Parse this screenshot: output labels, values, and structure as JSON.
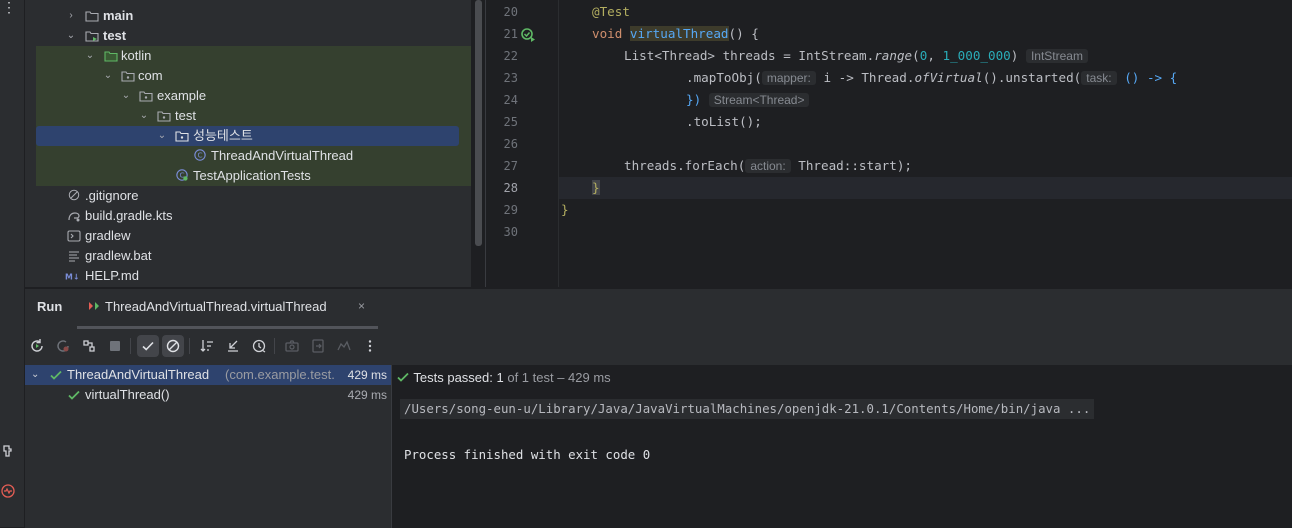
{
  "tree": {
    "rows": [
      {
        "label": "main"
      },
      {
        "label": "test"
      },
      {
        "label": "kotlin"
      },
      {
        "label": "com"
      },
      {
        "label": "example"
      },
      {
        "label": "test"
      },
      {
        "label": "성능테스트"
      },
      {
        "label": "ThreadAndVirtualThread"
      },
      {
        "label": "TestApplicationTests"
      },
      {
        "label": ".gitignore"
      },
      {
        "label": "build.gradle.kts"
      },
      {
        "label": "gradlew"
      },
      {
        "label": "gradlew.bat"
      },
      {
        "label": "HELP.md"
      }
    ]
  },
  "editor": {
    "line_numbers": [
      "20",
      "21",
      "22",
      "23",
      "24",
      "25",
      "26",
      "27",
      "28",
      "29",
      "30"
    ],
    "code": {
      "l20_ann": "@Test",
      "l21_kw": "void ",
      "l21_fn": "virtualThread",
      "l21_rest": "() {",
      "l22_a": "List<Thread> threads = IntStream.",
      "l22_b": "range",
      "l22_c": "(",
      "l22_n1": "0",
      "l22_d": ", ",
      "l22_n2": "1_000_000",
      "l22_e": ")",
      "l22_hint": "IntStream",
      "l23_a": ".mapToObj(",
      "l23_hint1": "mapper:",
      "l23_b": " i -> Thread.",
      "l23_c": "ofVirtual",
      "l23_d": "().unstarted(",
      "l23_hint2": "task:",
      "l23_e": " () -> {",
      "l24_a": "})",
      "l24_hint": "Stream<Thread>",
      "l25_a": ".toList();",
      "l27_a": "threads.forEach(",
      "l27_hint": "action:",
      "l27_b": " Thread::start);",
      "l28_a": "}",
      "l29_a": "}"
    }
  },
  "run_panel": {
    "tab_run": "Run",
    "tab_config": "ThreadAndVirtualThread.virtualThread",
    "tab_close": "×",
    "results": {
      "root_label": "ThreadAndVirtualThread",
      "root_pkg": "(com.example.test.",
      "root_duration": "429 ms",
      "child_label": "virtualThread()",
      "child_duration": "429 ms"
    },
    "console": {
      "passed_label": "Tests passed: ",
      "passed_count": "1",
      "passed_detail": " of 1 test – 429 ms",
      "path_line": "/Users/song-eun-u/Library/Java/JavaVirtualMachines/openjdk-21.0.1/Contents/Home/bin/java ...",
      "exit_line": "Process finished with exit code 0"
    }
  },
  "colors": {
    "accent_green": "#5fb865",
    "selection": "#2e436e",
    "test_highlight": "#35402f"
  },
  "icons": [
    "folder-icon",
    "kotlin-class-icon",
    "gitignore-icon",
    "gradle-icon",
    "terminal-icon",
    "markdown-icon",
    "rerun-icon",
    "check-icon",
    "stop-icon"
  ]
}
